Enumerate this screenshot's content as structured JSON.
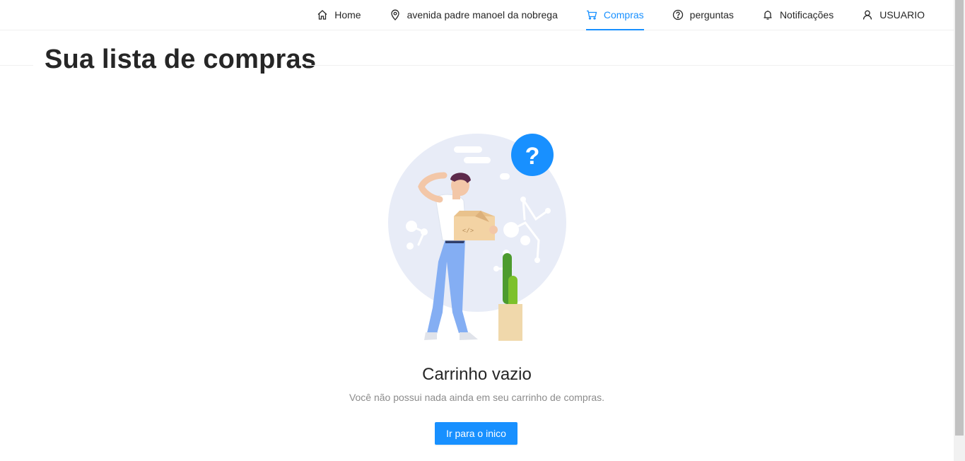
{
  "nav": {
    "items": [
      {
        "label": "Home",
        "icon": "home-icon"
      },
      {
        "label": "avenida padre manoel da nobrega",
        "icon": "location-pin-icon"
      },
      {
        "label": "Compras",
        "icon": "cart-icon",
        "active": true
      },
      {
        "label": "perguntas",
        "icon": "question-circle-icon"
      },
      {
        "label": "Notificações",
        "icon": "bell-icon"
      },
      {
        "label": "USUARIO",
        "icon": "user-icon"
      }
    ]
  },
  "page": {
    "title": "Sua lista de compras"
  },
  "empty_state": {
    "title": "Carrinho vazio",
    "subtitle": "Você não possui nada ainda em seu carrinho de compras.",
    "button_label": "Ir para o inico",
    "illustration": "confused-person-with-empty-box"
  },
  "colors": {
    "accent": "#1890ff",
    "text": "#262626",
    "muted": "#8c8c8c"
  }
}
